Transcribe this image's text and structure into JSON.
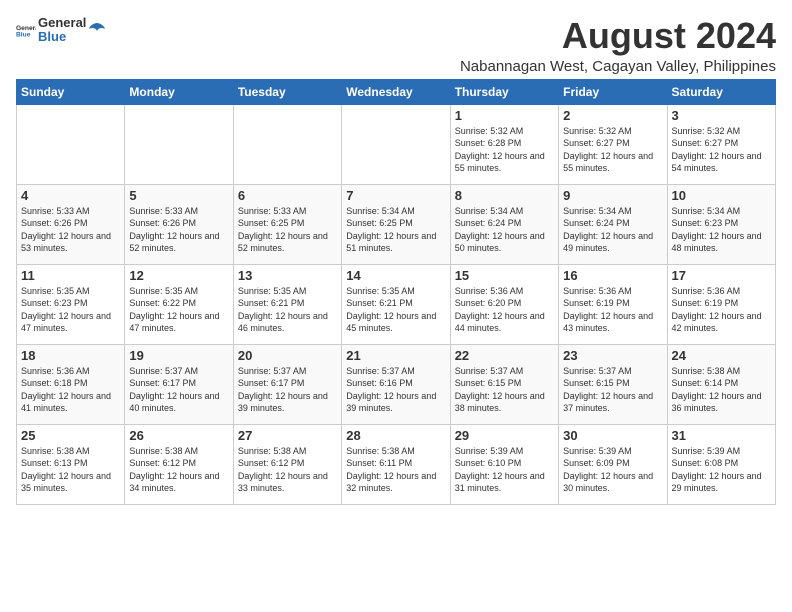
{
  "header": {
    "logo_general": "General",
    "logo_blue": "Blue",
    "month_year": "August 2024",
    "location": "Nabannagan West, Cagayan Valley, Philippines"
  },
  "days_of_week": [
    "Sunday",
    "Monday",
    "Tuesday",
    "Wednesday",
    "Thursday",
    "Friday",
    "Saturday"
  ],
  "weeks": [
    [
      {
        "day": "",
        "empty": true
      },
      {
        "day": "",
        "empty": true
      },
      {
        "day": "",
        "empty": true
      },
      {
        "day": "",
        "empty": true
      },
      {
        "day": "1",
        "sunrise": "5:32 AM",
        "sunset": "6:28 PM",
        "daylight": "12 hours and 55 minutes."
      },
      {
        "day": "2",
        "sunrise": "5:32 AM",
        "sunset": "6:27 PM",
        "daylight": "12 hours and 55 minutes."
      },
      {
        "day": "3",
        "sunrise": "5:32 AM",
        "sunset": "6:27 PM",
        "daylight": "12 hours and 54 minutes."
      }
    ],
    [
      {
        "day": "4",
        "sunrise": "5:33 AM",
        "sunset": "6:26 PM",
        "daylight": "12 hours and 53 minutes."
      },
      {
        "day": "5",
        "sunrise": "5:33 AM",
        "sunset": "6:26 PM",
        "daylight": "12 hours and 52 minutes."
      },
      {
        "day": "6",
        "sunrise": "5:33 AM",
        "sunset": "6:25 PM",
        "daylight": "12 hours and 52 minutes."
      },
      {
        "day": "7",
        "sunrise": "5:34 AM",
        "sunset": "6:25 PM",
        "daylight": "12 hours and 51 minutes."
      },
      {
        "day": "8",
        "sunrise": "5:34 AM",
        "sunset": "6:24 PM",
        "daylight": "12 hours and 50 minutes."
      },
      {
        "day": "9",
        "sunrise": "5:34 AM",
        "sunset": "6:24 PM",
        "daylight": "12 hours and 49 minutes."
      },
      {
        "day": "10",
        "sunrise": "5:34 AM",
        "sunset": "6:23 PM",
        "daylight": "12 hours and 48 minutes."
      }
    ],
    [
      {
        "day": "11",
        "sunrise": "5:35 AM",
        "sunset": "6:23 PM",
        "daylight": "12 hours and 47 minutes."
      },
      {
        "day": "12",
        "sunrise": "5:35 AM",
        "sunset": "6:22 PM",
        "daylight": "12 hours and 47 minutes."
      },
      {
        "day": "13",
        "sunrise": "5:35 AM",
        "sunset": "6:21 PM",
        "daylight": "12 hours and 46 minutes."
      },
      {
        "day": "14",
        "sunrise": "5:35 AM",
        "sunset": "6:21 PM",
        "daylight": "12 hours and 45 minutes."
      },
      {
        "day": "15",
        "sunrise": "5:36 AM",
        "sunset": "6:20 PM",
        "daylight": "12 hours and 44 minutes."
      },
      {
        "day": "16",
        "sunrise": "5:36 AM",
        "sunset": "6:19 PM",
        "daylight": "12 hours and 43 minutes."
      },
      {
        "day": "17",
        "sunrise": "5:36 AM",
        "sunset": "6:19 PM",
        "daylight": "12 hours and 42 minutes."
      }
    ],
    [
      {
        "day": "18",
        "sunrise": "5:36 AM",
        "sunset": "6:18 PM",
        "daylight": "12 hours and 41 minutes."
      },
      {
        "day": "19",
        "sunrise": "5:37 AM",
        "sunset": "6:17 PM",
        "daylight": "12 hours and 40 minutes."
      },
      {
        "day": "20",
        "sunrise": "5:37 AM",
        "sunset": "6:17 PM",
        "daylight": "12 hours and 39 minutes."
      },
      {
        "day": "21",
        "sunrise": "5:37 AM",
        "sunset": "6:16 PM",
        "daylight": "12 hours and 39 minutes."
      },
      {
        "day": "22",
        "sunrise": "5:37 AM",
        "sunset": "6:15 PM",
        "daylight": "12 hours and 38 minutes."
      },
      {
        "day": "23",
        "sunrise": "5:37 AM",
        "sunset": "6:15 PM",
        "daylight": "12 hours and 37 minutes."
      },
      {
        "day": "24",
        "sunrise": "5:38 AM",
        "sunset": "6:14 PM",
        "daylight": "12 hours and 36 minutes."
      }
    ],
    [
      {
        "day": "25",
        "sunrise": "5:38 AM",
        "sunset": "6:13 PM",
        "daylight": "12 hours and 35 minutes."
      },
      {
        "day": "26",
        "sunrise": "5:38 AM",
        "sunset": "6:12 PM",
        "daylight": "12 hours and 34 minutes."
      },
      {
        "day": "27",
        "sunrise": "5:38 AM",
        "sunset": "6:12 PM",
        "daylight": "12 hours and 33 minutes."
      },
      {
        "day": "28",
        "sunrise": "5:38 AM",
        "sunset": "6:11 PM",
        "daylight": "12 hours and 32 minutes."
      },
      {
        "day": "29",
        "sunrise": "5:39 AM",
        "sunset": "6:10 PM",
        "daylight": "12 hours and 31 minutes."
      },
      {
        "day": "30",
        "sunrise": "5:39 AM",
        "sunset": "6:09 PM",
        "daylight": "12 hours and 30 minutes."
      },
      {
        "day": "31",
        "sunrise": "5:39 AM",
        "sunset": "6:08 PM",
        "daylight": "12 hours and 29 minutes."
      }
    ]
  ],
  "labels": {
    "sunrise_prefix": "Sunrise: ",
    "sunset_prefix": "Sunset: ",
    "daylight_prefix": "Daylight: "
  }
}
